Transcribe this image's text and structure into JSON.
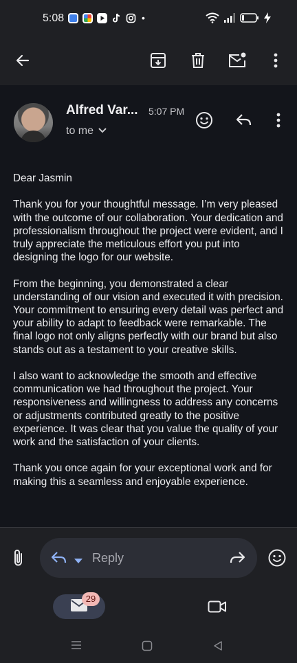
{
  "status_bar": {
    "time": "5:08",
    "app_icons": [
      "app-icon-blue",
      "app-icon-photos",
      "youtube-icon",
      "tiktok-icon",
      "instagram-icon"
    ],
    "dot": "•"
  },
  "message": {
    "sender": "Alfred Var...",
    "time": "5:07 PM",
    "recipient": "to me",
    "greeting": "Dear Jasmin",
    "paragraphs": [
      "Thank you for your thoughtful message. I’m very pleased with the outcome of our collaboration. Your dedication and professionalism throughout the project were evident, and I truly appreciate the meticulous effort you put into designing the logo for our website.",
      "From the beginning, you demonstrated a clear understanding of our vision and executed it with precision. Your commitment to ensuring every detail was perfect and your ability to adapt to feedback were remarkable. The final logo not only aligns perfectly with our brand but also stands out as a testament to your creative skills.",
      "I also want to acknowledge the smooth and effective communication we had throughout the project. Your responsiveness and willingness to address any concerns or adjustments contributed greatly to the positive experience. It was clear that you value the quality of your work and the satisfaction of your clients.",
      "Thank you once again for your exceptional work and for making this a seamless and enjoyable experience."
    ]
  },
  "reply_bar": {
    "placeholder": "Reply"
  },
  "bottom_nav": {
    "mail_badge": "29"
  },
  "colors": {
    "background": "#1f2024",
    "content_background": "#13151b",
    "badge": "#f2b8b5",
    "pill": "#3a4052"
  }
}
